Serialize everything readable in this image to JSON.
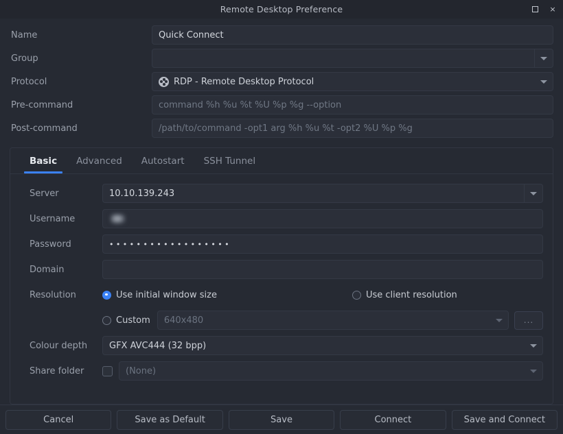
{
  "titlebar": {
    "title": "Remote Desktop Preference",
    "maximize_icon": "maximize-icon",
    "close_icon": "close-icon",
    "close_glyph": "×"
  },
  "form": {
    "name": {
      "label": "Name",
      "value": "Quick Connect"
    },
    "group": {
      "label": "Group",
      "value": ""
    },
    "protocol": {
      "label": "Protocol",
      "value": "RDP - Remote Desktop Protocol",
      "icon": "rdp-protocol-icon"
    },
    "pre_command": {
      "label": "Pre-command",
      "placeholder": "command %h %u %t %U %p %g --option",
      "value": ""
    },
    "post_command": {
      "label": "Post-command",
      "placeholder": "/path/to/command -opt1 arg %h %u %t -opt2 %U %p %g",
      "value": ""
    }
  },
  "tabs": [
    {
      "label": "Basic",
      "active": true
    },
    {
      "label": "Advanced",
      "active": false
    },
    {
      "label": "Autostart",
      "active": false
    },
    {
      "label": "SSH Tunnel",
      "active": false
    }
  ],
  "basic": {
    "server": {
      "label": "Server",
      "value": "10.10.139.243"
    },
    "username": {
      "label": "Username",
      "value": "",
      "redacted": true
    },
    "password": {
      "label": "Password",
      "masked_value": "••••••••••••••••••"
    },
    "domain": {
      "label": "Domain",
      "value": ""
    },
    "resolution": {
      "label": "Resolution",
      "option_initial": "Use initial window size",
      "option_client": "Use client resolution",
      "option_custom": "Custom",
      "selected": "Use initial window size",
      "custom_placeholder": "640x480",
      "browse_label": "..."
    },
    "colour_depth": {
      "label": "Colour depth",
      "value": "GFX AVC444 (32 bpp)"
    },
    "share_folder": {
      "label": "Share folder",
      "checked": false,
      "value": "(None)"
    }
  },
  "footer": {
    "buttons": [
      {
        "label": "Cancel"
      },
      {
        "label": "Save as Default"
      },
      {
        "label": "Save"
      },
      {
        "label": "Connect"
      },
      {
        "label": "Save and Connect"
      }
    ]
  },
  "colors": {
    "accent": "#3b82f6",
    "window_bg": "#262a33",
    "titlebar_bg": "#23262e",
    "field_bg": "#2b2f39",
    "text": "#cfd3da",
    "muted_text": "#9aa0ab",
    "placeholder": "#707885"
  }
}
